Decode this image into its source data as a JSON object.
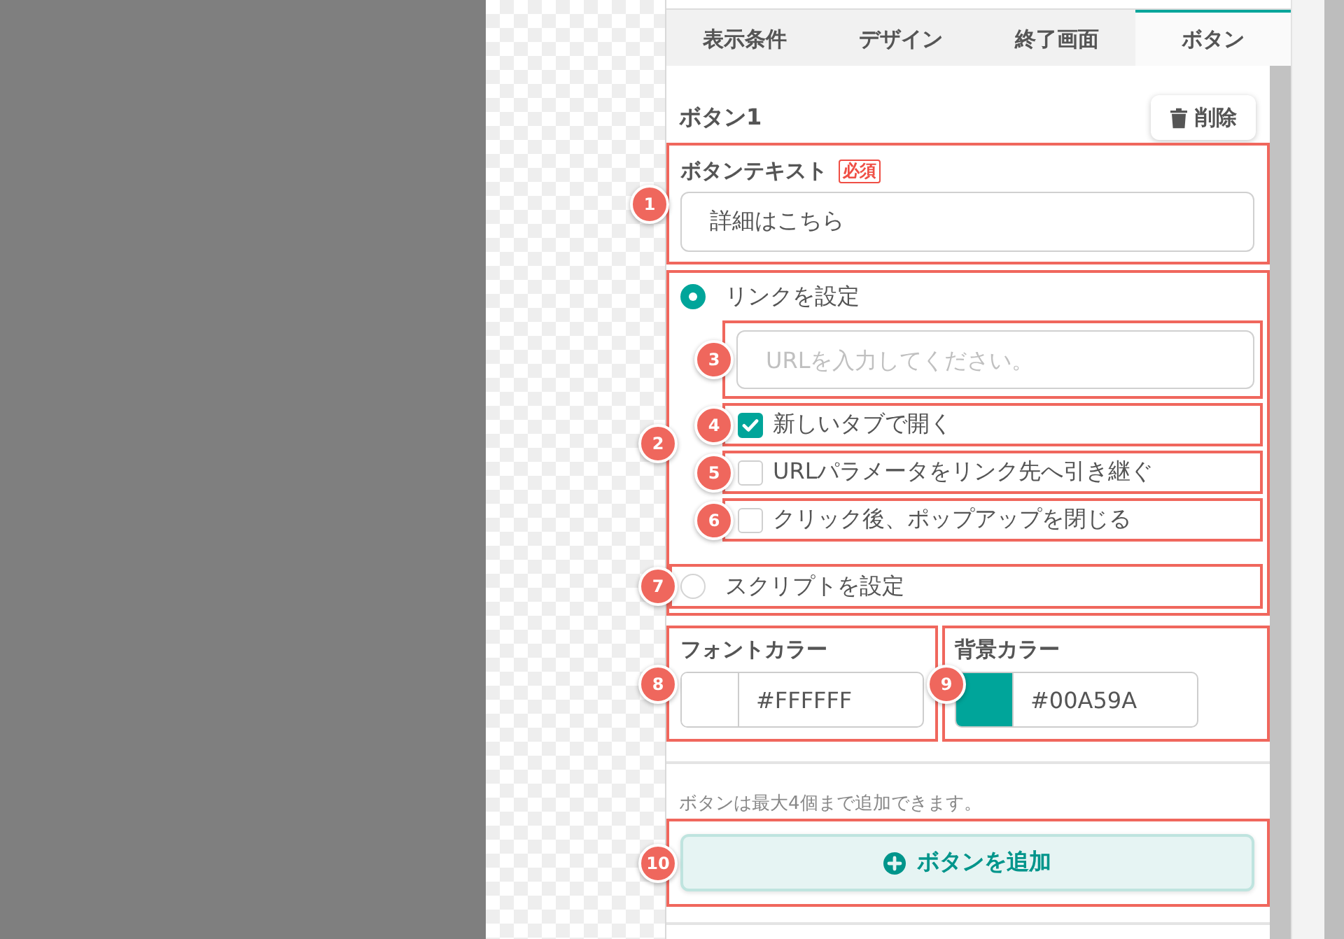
{
  "panel": {
    "tabs": [
      {
        "label": "表示条件",
        "selected": false
      },
      {
        "label": "デザイン",
        "selected": false
      },
      {
        "label": "終了画面",
        "selected": false
      },
      {
        "label": "ボタン",
        "selected": true
      }
    ]
  },
  "button_settings": {
    "title": "ボタン1",
    "delete_button": "削除",
    "button_text": {
      "marker": "1",
      "label": "ボタンテキスト",
      "required_badge": "必須",
      "value": "詳細はこちら"
    },
    "action": {
      "marker": "2",
      "options": [
        {
          "kind": "link",
          "label": "リンクを設定",
          "selected": true,
          "url_field": {
            "marker": "3",
            "placeholder": "URLを入力してください。"
          },
          "checkboxes": [
            {
              "marker": "4",
              "label": "新しいタブで開く",
              "checked": true
            },
            {
              "marker": "5",
              "label": "URLパラメータをリンク先へ引き継ぐ",
              "checked": false
            },
            {
              "marker": "6",
              "label": "クリック後、ポップアップを閉じる",
              "checked": false
            }
          ]
        },
        {
          "kind": "script",
          "marker": "7",
          "label": "スクリプトを設定",
          "selected": false
        }
      ]
    },
    "colors": [
      {
        "marker": "8",
        "label": "フォントカラー",
        "value": "#FFFFFF",
        "color": "#ffffff"
      },
      {
        "marker": "9",
        "label": "背景カラー",
        "value": "#00A59A",
        "color": "#00a59a"
      }
    ]
  },
  "limit_note": "ボタンは最大4個まで追加できます。",
  "add_button": {
    "marker": "10",
    "label": "ボタンを追加"
  }
}
